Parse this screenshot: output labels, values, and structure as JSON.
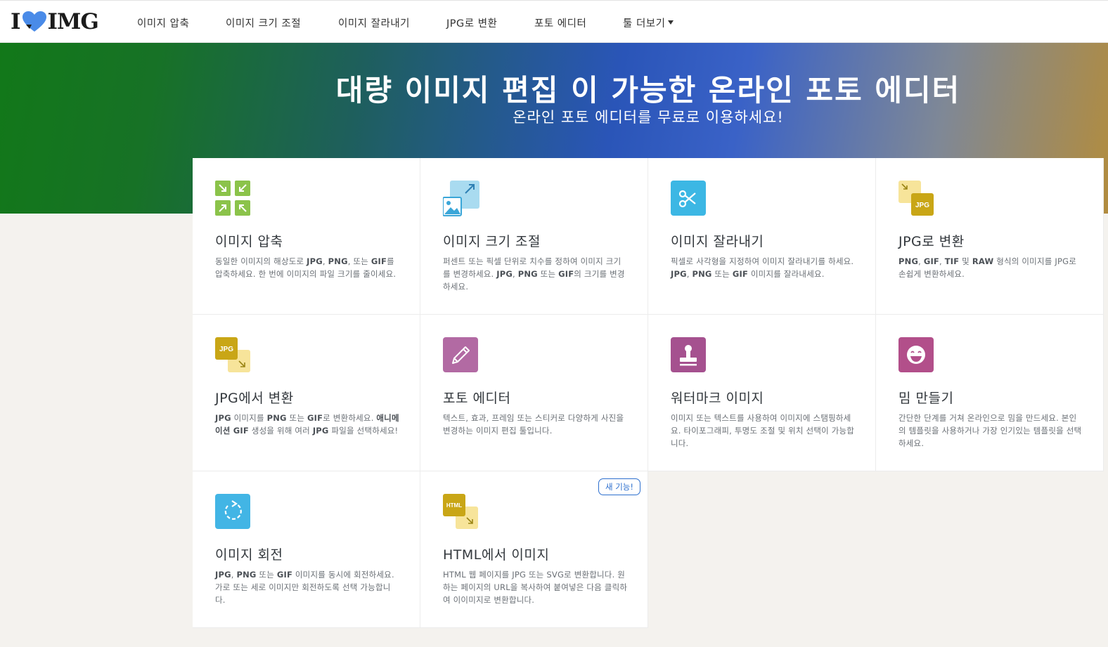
{
  "brand": {
    "logo_left": "I",
    "logo_right": "IMG"
  },
  "nav": {
    "items": [
      "이미지 압축",
      "이미지 크기 조절",
      "이미지 잘라내기",
      "JPG로 변환",
      "포토 에디터"
    ],
    "more_label": "툴 더보기"
  },
  "hero": {
    "title": "대량 이미지 편집 이 가능한 온라인 포토 에디터",
    "subtitle": "온라인 포토 에디터를 무료로 이용하세요!"
  },
  "tools": [
    {
      "title": "이미지 압축",
      "icon": "compress-icon",
      "desc": [
        [
          "동일한 이미지의 해상도로 ",
          false
        ],
        [
          "JPG",
          true
        ],
        [
          ", ",
          false
        ],
        [
          "PNG",
          true
        ],
        [
          ", 또는 ",
          false
        ],
        [
          "GIF",
          true
        ],
        [
          "를 압축하세요. 한 번에 이미지의 파일 크기를 줄이세요.",
          false
        ]
      ]
    },
    {
      "title": "이미지 크기 조절",
      "icon": "resize-icon",
      "desc": [
        [
          "퍼센트 또는 픽셀 단위로 치수를 정하여 이미지 크기를 변경하세요. ",
          false
        ],
        [
          "JPG",
          true
        ],
        [
          ", ",
          false
        ],
        [
          "PNG",
          true
        ],
        [
          " 또는 ",
          false
        ],
        [
          "GIF",
          true
        ],
        [
          "의 크기를 변경하세요.",
          false
        ]
      ]
    },
    {
      "title": "이미지 잘라내기",
      "icon": "crop-scissors-icon",
      "desc": [
        [
          "픽셀로 사각형을 지정하여 이미지 잘라내기를 하세요. ",
          false
        ],
        [
          "JPG",
          true
        ],
        [
          ", ",
          false
        ],
        [
          "PNG",
          true
        ],
        [
          " 또는 ",
          false
        ],
        [
          "GIF",
          true
        ],
        [
          " 이미지를 잘라내세요.",
          false
        ]
      ]
    },
    {
      "title": "JPG로 변환",
      "icon": "convert-to-jpg-icon",
      "icon_label": "JPG",
      "desc": [
        [
          "PNG",
          true
        ],
        [
          ", ",
          false
        ],
        [
          "GIF",
          true
        ],
        [
          ", ",
          false
        ],
        [
          "TIF",
          true
        ],
        [
          " 및 ",
          false
        ],
        [
          "RAW",
          true
        ],
        [
          " 형식의 이미지를 JPG로 손쉽게 변환하세요.",
          false
        ]
      ]
    },
    {
      "title": "JPG에서 변환",
      "icon": "convert-from-jpg-icon",
      "icon_label": "JPG",
      "desc": [
        [
          "JPG",
          true
        ],
        [
          " 이미지를 ",
          false
        ],
        [
          "PNG",
          true
        ],
        [
          " 또는 ",
          false
        ],
        [
          "GIF",
          true
        ],
        [
          "로 변환하세요. ",
          false
        ],
        [
          "애니메이션 GIF",
          true
        ],
        [
          " 생성을 위해 여러 ",
          false
        ],
        [
          "JPG",
          true
        ],
        [
          " 파일을 선택하세요!",
          false
        ]
      ]
    },
    {
      "title": "포토 에디터",
      "icon": "photo-editor-pencil-icon",
      "desc": [
        [
          "텍스트, 효과, 프레임 또는 스티커로 다양하게 사진을 변경하는 이미지 편집 툴입니다.",
          false
        ]
      ]
    },
    {
      "title": "워터마크 이미지",
      "icon": "watermark-stamp-icon",
      "desc": [
        [
          "이미지 또는 텍스트를 사용하여 이미지에 스탬핑하세요. 타이포그래피, 투명도 조절 및 위치 선택이 가능합니다.",
          false
        ]
      ]
    },
    {
      "title": "밈 만들기",
      "icon": "meme-face-icon",
      "desc": [
        [
          "간단한 단계를 거쳐 온라인으로 밈을 만드세요. 본인의 템플릿을 사용하거나 가장 인기있는 템플릿을 선택하세요.",
          false
        ]
      ]
    },
    {
      "title": "이미지 회전",
      "icon": "rotate-icon",
      "desc": [
        [
          "JPG",
          true
        ],
        [
          ", ",
          false
        ],
        [
          "PNG",
          true
        ],
        [
          " 또는 ",
          false
        ],
        [
          "GIF",
          true
        ],
        [
          " 이미지를 동시에 회전하세요. 가로 또는 세로 이미지만 회전하도록 선택 가능합니다.",
          false
        ]
      ]
    },
    {
      "title": "HTML에서 이미지",
      "icon": "html-to-image-icon",
      "icon_label": "HTML",
      "badge": "새 기능!",
      "desc": [
        [
          "HTML 웹 페이지를 JPG 또는 SVG로 변환합니다. 원하는 페이지의 URL을 복사하여 붙여넣은 다음 클릭하여 이이미지로 변환합니다.",
          false
        ]
      ]
    }
  ],
  "colors": {
    "compress": "#8bc34a",
    "resize": "#9fd4ec",
    "crop": "#3cb7e4",
    "jpg": "#c9a616",
    "editor": "#b26aa3",
    "watermark": "#a5518f",
    "meme": "#b24f8a",
    "rotate": "#42b5e5",
    "html": "#c9a616",
    "heart": "#4a8be8"
  }
}
